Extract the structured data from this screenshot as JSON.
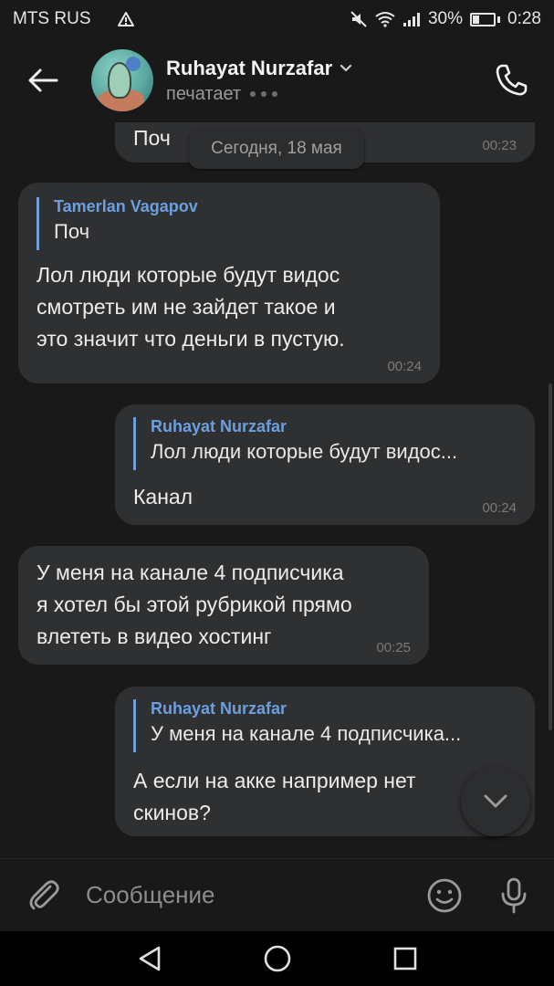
{
  "status_bar": {
    "carrier": "MTS RUS",
    "battery_percent": "30%",
    "battery_level": 0.3,
    "time": "0:28"
  },
  "header": {
    "contact_name": "Ruhayat Nurzafar",
    "status": "печатает"
  },
  "date_separator": "Сегодня, 18 мая",
  "messages": [
    {
      "direction": "outgoing",
      "text": "Поч",
      "time": "00:23"
    },
    {
      "direction": "incoming",
      "reply_author": "Tamerlan Vagapov",
      "reply_text": "Поч",
      "lines": [
        "Лол люди которые будут видос",
        "смотреть им не зайдет такое и",
        "это значит что деньги в пустую."
      ],
      "time": "00:24"
    },
    {
      "direction": "outgoing",
      "reply_author": "Ruhayat Nurzafar",
      "reply_text": "Лол люди которые будут видос...",
      "text": "Канал",
      "time": "00:24"
    },
    {
      "direction": "incoming",
      "lines": [
        "У меня на канале 4 подписчика",
        "я хотел бы этой рубрикой прямо",
        "влететь в видео хостинг"
      ],
      "time": "00:25"
    },
    {
      "direction": "outgoing",
      "reply_author": "Ruhayat Nurzafar",
      "reply_text": "У меня на канале 4 подписчика...",
      "lines": [
        "А если на акке например нет",
        "скинов?"
      ]
    }
  ],
  "composer": {
    "placeholder": "Сообщение"
  },
  "icons": {
    "back": "arrow-left-icon",
    "name_dropdown": "chevron-down-icon",
    "call": "phone-icon",
    "scroll_down": "chevron-down-icon",
    "attach": "paperclip-icon",
    "emoji": "smiley-icon",
    "mic": "microphone-icon",
    "nav_back": "triangle-back-icon",
    "nav_home": "circle-home-icon",
    "nav_recents": "square-recents-icon"
  },
  "colors": {
    "background": "#19191a",
    "bubble": "#2f3032",
    "accent_blue": "#6c9fdc",
    "time_gray": "#7a7a7a"
  }
}
